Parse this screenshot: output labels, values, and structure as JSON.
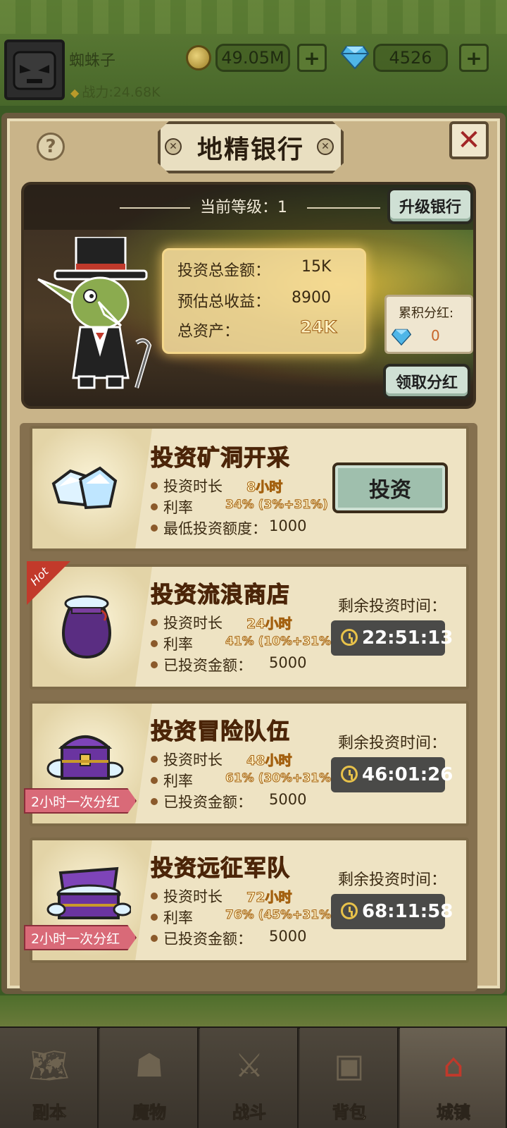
{
  "player": {
    "name": "蜘蛛子",
    "power": "战力:24.68K",
    "gold": "49.05M",
    "gems": "4526",
    "plus": "+"
  },
  "bank": {
    "help": "?",
    "title": "地精银行",
    "close": "✕",
    "level_label": "当前等级：1",
    "upgrade": "升级银行",
    "total_invest_label": "投资总金额：",
    "total_invest_value": "15K",
    "est_income_label": "预估总收益：",
    "est_income_value": "8900",
    "total_assets_label": "总资产：",
    "total_assets_value": "24K",
    "dividend_label": "累积分红:",
    "dividend_value": "0",
    "claim": "领取分红"
  },
  "investments": [
    {
      "title": "投资矿洞开采",
      "duration_label": "投资时长",
      "duration": "8小时",
      "rate_label": "利率",
      "rate": "34% (3%+31%)",
      "amount_label": "最低投资额度：",
      "amount": "1000",
      "action": "投资"
    },
    {
      "title": "投资流浪商店",
      "tag": "Hot",
      "duration_label": "投资时长",
      "duration": "24小时",
      "rate_label": "利率",
      "rate": "41% (10%+31%)",
      "amount_label": "已投资金额：",
      "amount": "5000",
      "remain_label": "剩余投资时间：",
      "timer": "22:51:13"
    },
    {
      "title": "投资冒险队伍",
      "ribbon": "2小时一次分红",
      "duration_label": "投资时长",
      "duration": "48小时",
      "rate_label": "利率",
      "rate": "61% (30%+31%)",
      "amount_label": "已投资金额：",
      "amount": "5000",
      "remain_label": "剩余投资时间：",
      "timer": "46:01:26"
    },
    {
      "title": "投资远征军队",
      "ribbon": "2小时一次分红",
      "duration_label": "投资时长",
      "duration": "72小时",
      "rate_label": "利率",
      "rate": "76% (45%+31%)",
      "amount_label": "已投资金额：",
      "amount": "5000",
      "remain_label": "剩余投资时间：",
      "timer": "68:11:58"
    }
  ],
  "nav": [
    {
      "label": "副本",
      "icon": "map-icon"
    },
    {
      "label": "魔物",
      "icon": "monster-icon"
    },
    {
      "label": "战斗",
      "icon": "swords-icon"
    },
    {
      "label": "背包",
      "icon": "backpack-icon"
    },
    {
      "label": "城镇",
      "icon": "town-icon"
    }
  ],
  "colors": {
    "accent_gold": "#e8c24a",
    "button_green": "#cfe0d4",
    "close_red": "#a12525",
    "ribbon_pink": "#d96a78"
  }
}
